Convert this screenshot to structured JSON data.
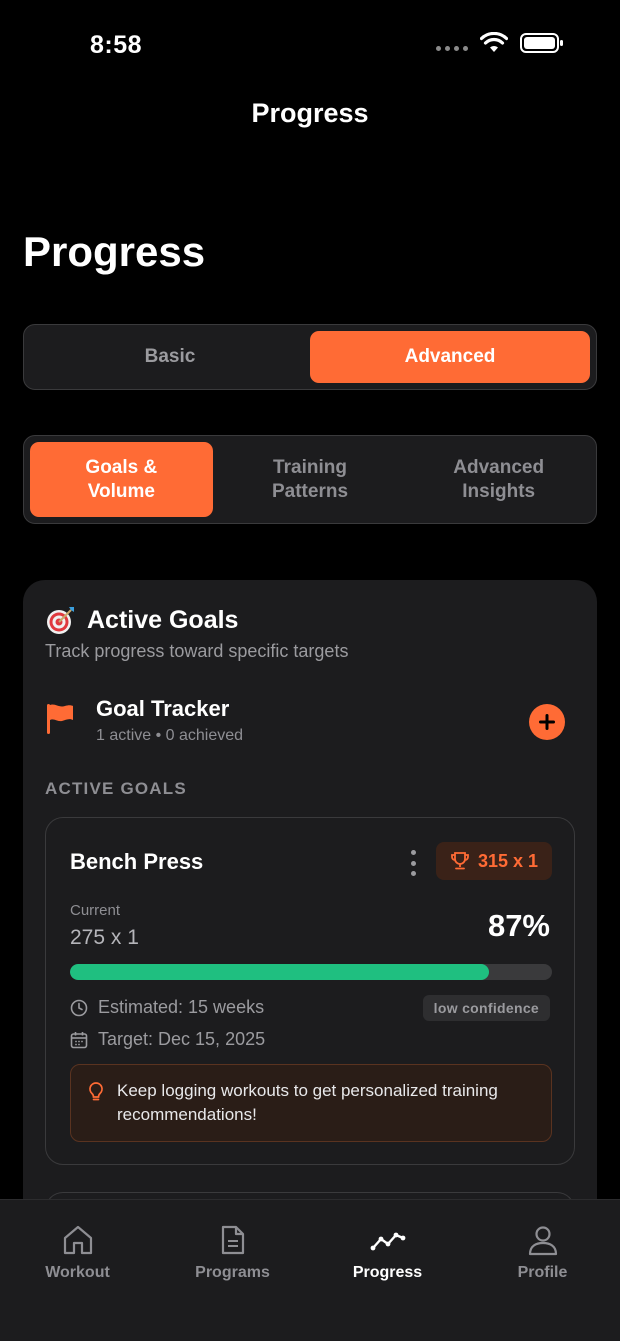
{
  "status_bar": {
    "time": "8:58"
  },
  "nav": {
    "title": "Progress"
  },
  "page": {
    "title": "Progress"
  },
  "mode_toggle": {
    "options": [
      "Basic",
      "Advanced"
    ],
    "selected": "Advanced"
  },
  "sub_tabs": {
    "items": [
      {
        "label": "Goals &\nVolume",
        "line1": "Goals &",
        "line2": "Volume"
      },
      {
        "label": "Training\nPatterns",
        "line1": "Training",
        "line2": "Patterns"
      },
      {
        "label": "Advanced\nInsights",
        "line1": "Advanced",
        "line2": "Insights"
      }
    ],
    "selected_index": 0
  },
  "active_goals_card": {
    "icon": "target-dart-icon",
    "title": "Active Goals",
    "subtitle": "Track progress toward specific targets",
    "tracker": {
      "icon": "flag-icon",
      "title": "Goal Tracker",
      "summary": "1 active • 0 achieved",
      "add_icon": "plus-icon"
    },
    "section_label": "ACTIVE GOALS",
    "goals": [
      {
        "exercise": "Bench Press",
        "target": "315 x 1",
        "current_label": "Current",
        "current_value": "275 x 1",
        "percent_text": "87%",
        "progress_fraction": 0.87,
        "estimated": "Estimated: 15 weeks",
        "confidence": "low confidence",
        "target_date": "Target: Dec 15, 2025",
        "tip": "Keep logging workouts to get personalized training recommendations!"
      }
    ]
  },
  "tab_bar": {
    "items": [
      {
        "label": "Workout",
        "icon": "home-icon"
      },
      {
        "label": "Programs",
        "icon": "document-icon"
      },
      {
        "label": "Progress",
        "icon": "trend-line-icon"
      },
      {
        "label": "Profile",
        "icon": "person-icon"
      }
    ],
    "selected": "Progress"
  },
  "colors": {
    "accent": "#ff6b35",
    "progress": "#1fbf80",
    "background": "#000000",
    "card": "#1c1c1e"
  }
}
